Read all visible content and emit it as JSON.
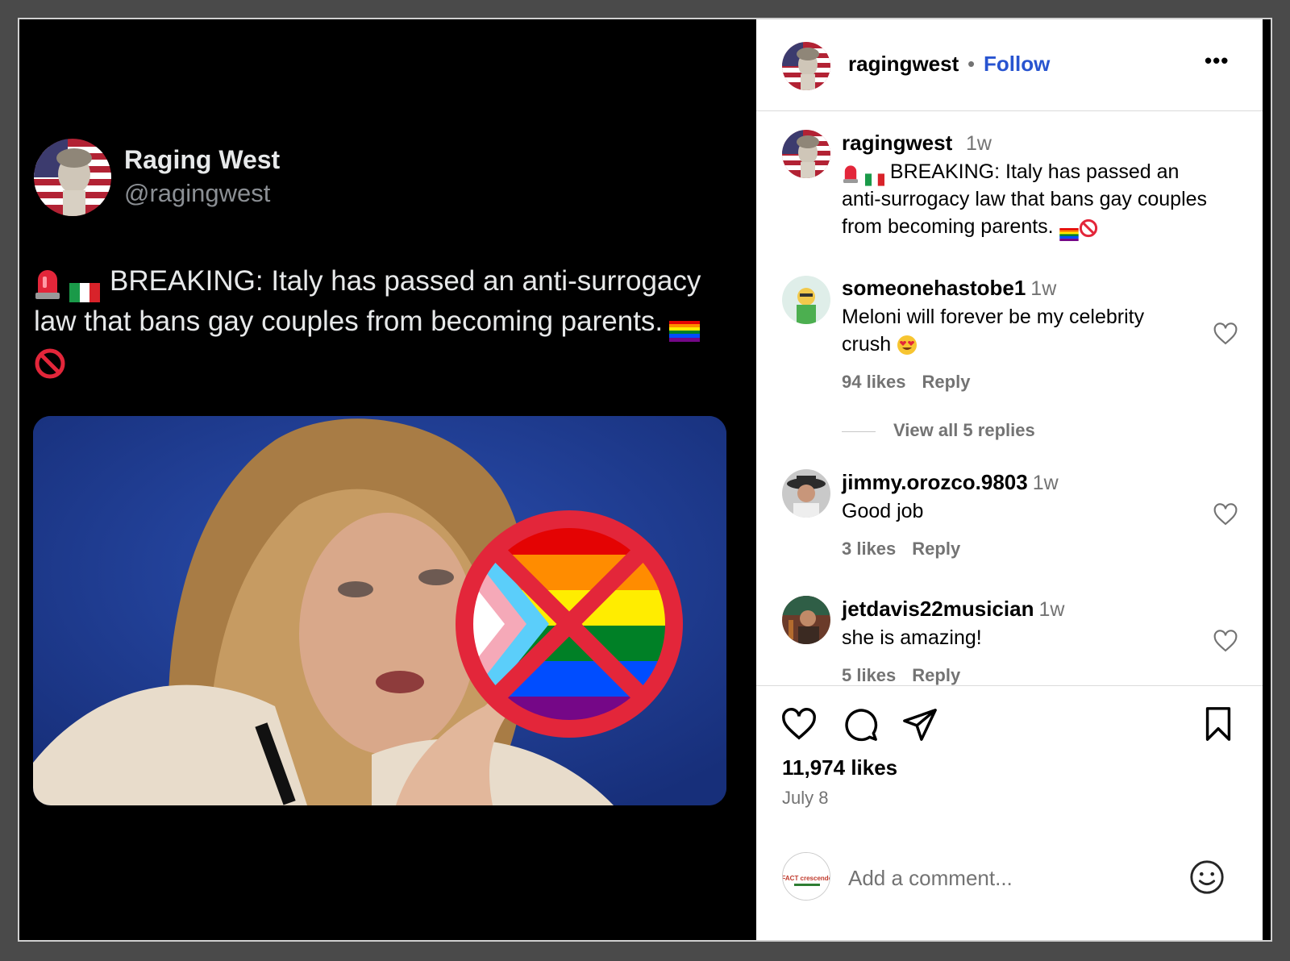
{
  "tweet": {
    "display_name": "Raging West",
    "handle": "@ragingwest",
    "text": "BREAKING: Italy has passed an anti-surrogacy law that bans gay couples from becoming parents."
  },
  "post": {
    "header": {
      "username": "ragingwest",
      "separator": "•",
      "follow_label": "Follow",
      "more_label": "•••"
    },
    "caption": {
      "username": "ragingwest",
      "time": "1w",
      "text": "BREAKING: Italy has passed an anti-surrogacy law that bans gay couples from becoming parents."
    },
    "comments": [
      {
        "username": "someonehastobe1",
        "time": "1w",
        "text": "Meloni will forever be my celebrity crush",
        "likes": "94 likes",
        "reply_label": "Reply",
        "view_replies": "View all 5 replies"
      },
      {
        "username": "jimmy.orozco.9803",
        "time": "1w",
        "text": "Good job",
        "likes": "3 likes",
        "reply_label": "Reply"
      },
      {
        "username": "jetdavis22musician",
        "time": "1w",
        "text": "she is amazing!",
        "likes": "5 likes",
        "reply_label": "Reply"
      }
    ],
    "like_count": "11,974 likes",
    "date": "July 8",
    "add_comment_placeholder": "Add a comment...",
    "commenter_avatar_text": "FACT crescendo"
  },
  "colors": {
    "follow_blue": "#2854d0",
    "muted_gray": "#737373",
    "tweet_bg": "#000000",
    "image_bg_blue": "#1f3a8a"
  },
  "icons": [
    "siren-emoji",
    "italy-flag-emoji",
    "rainbow-flag-emoji",
    "no-entry-emoji",
    "heart-icon",
    "comment-icon",
    "share-icon",
    "bookmark-icon",
    "smiley-icon",
    "more-icon"
  ]
}
